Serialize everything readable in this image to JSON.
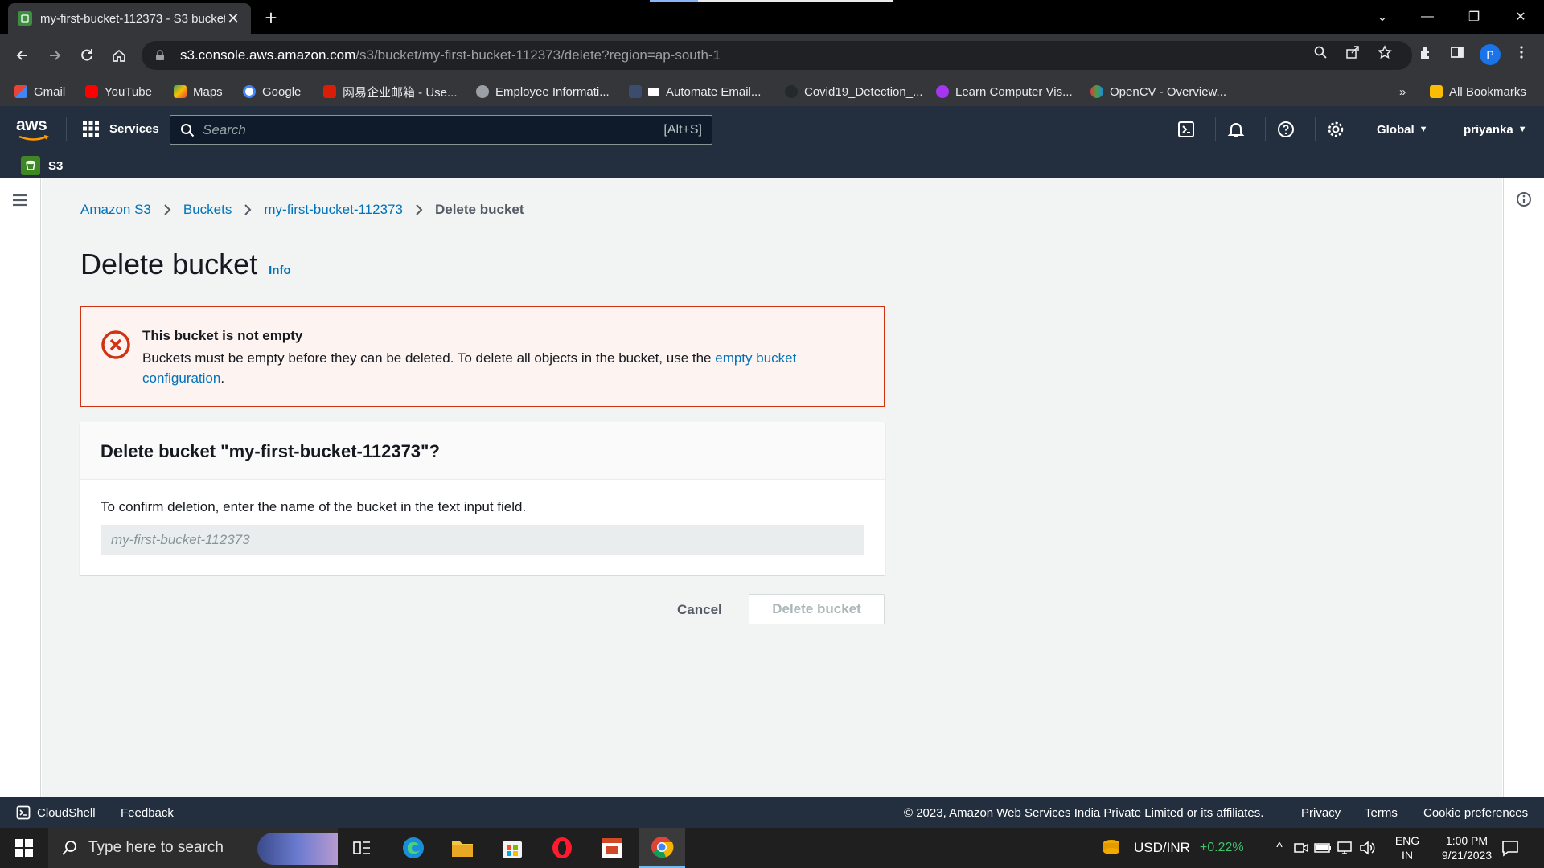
{
  "browser": {
    "tab_title": "my-first-bucket-112373 - S3 bucket",
    "url_host": "s3.console.aws.amazon.com",
    "url_path": "/s3/bucket/my-first-bucket-112373/delete?region=ap-south-1",
    "profile_initial": "P",
    "bookmarks": [
      "Gmail",
      "YouTube",
      "Maps",
      "Google",
      "网易企业邮箱 - Use...",
      "Employee Informati...",
      "Automate Email...",
      "Covid19_Detection_...",
      "Learn Computer Vis...",
      "OpenCV - Overview..."
    ],
    "all_bookmarks": "All Bookmarks",
    "overflow": "»"
  },
  "aws_nav": {
    "logo": "aws",
    "services": "Services",
    "search_placeholder": "Search",
    "search_shortcut": "[Alt+S]",
    "region": "Global",
    "user": "priyanka",
    "service_name": "S3"
  },
  "breadcrumb": {
    "items": [
      "Amazon S3",
      "Buckets",
      "my-first-bucket-112373"
    ],
    "current": "Delete bucket"
  },
  "page": {
    "title": "Delete bucket",
    "info": "Info"
  },
  "alert": {
    "title": "This bucket is not empty",
    "body_prefix": "Buckets must be empty before they can be deleted. To delete all objects in the bucket, use the ",
    "link": "empty bucket configuration",
    "body_suffix": "."
  },
  "confirm": {
    "heading": "Delete bucket \"my-first-bucket-112373\"?",
    "label": "To confirm deletion, enter the name of the bucket in the text input field.",
    "input_placeholder": "my-first-bucket-112373",
    "input_value": ""
  },
  "actions": {
    "cancel": "Cancel",
    "delete": "Delete bucket"
  },
  "footer": {
    "cloudshell": "CloudShell",
    "feedback": "Feedback",
    "copyright": "© 2023, Amazon Web Services India Private Limited or its affiliates.",
    "privacy": "Privacy",
    "terms": "Terms",
    "cookies": "Cookie preferences"
  },
  "taskbar": {
    "search_placeholder": "Type here to search",
    "ticker_name": "USD/INR",
    "ticker_change": "+0.22%",
    "lang_top": "ENG",
    "lang_bottom": "IN",
    "time": "1:00 PM",
    "date": "9/21/2023"
  },
  "colors": {
    "aws_nav": "#232f3e",
    "link": "#0073bb",
    "error": "#d13212",
    "ticker_up": "#3ec46d"
  }
}
